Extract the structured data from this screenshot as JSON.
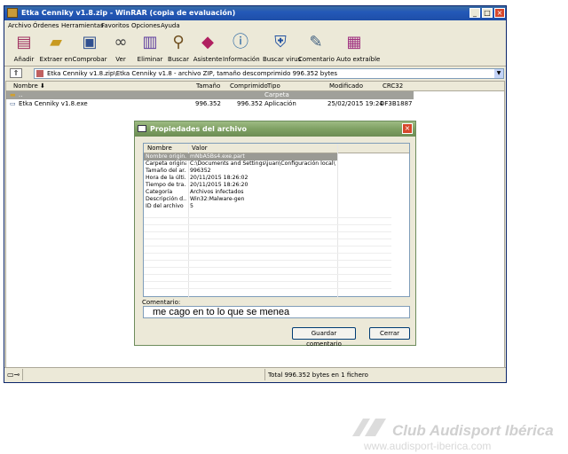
{
  "window": {
    "title": "Etka Cenniky v1.8.zip - WinRAR (copia de evaluación)",
    "controls": {
      "minimize": "_",
      "maximize": "□",
      "close": "×"
    }
  },
  "menu": [
    "Archivo",
    "Órdenes",
    "Herramientas",
    "Favoritos",
    "Opciones",
    "Ayuda"
  ],
  "toolbar": [
    {
      "label": "Añadir",
      "icon": "add-icon"
    },
    {
      "label": "Extraer en",
      "icon": "extract-icon"
    },
    {
      "label": "Comprobar",
      "icon": "test-icon"
    },
    {
      "label": "Ver",
      "icon": "view-icon"
    },
    {
      "label": "Eliminar",
      "icon": "delete-icon"
    },
    {
      "label": "Buscar",
      "icon": "find-icon"
    },
    {
      "label": "Asistente",
      "icon": "wizard-icon"
    },
    {
      "label": "Información",
      "icon": "info-icon"
    },
    {
      "label": "Buscar virus",
      "icon": "virus-scan-icon"
    },
    {
      "label": "Comentario",
      "icon": "comment-icon"
    },
    {
      "label": "Auto extraíble",
      "icon": "sfx-icon"
    }
  ],
  "path": "Etka Cenniky v1.8.zip\\Etka Cenniky v1.8 - archivo ZIP, tamaño descomprimido 996.352 bytes",
  "columns": [
    "Nombre",
    "Tamaño",
    "Comprimido",
    "Tipo",
    "Modificado",
    "CRC32"
  ],
  "files": [
    {
      "name": "..",
      "size": "",
      "packed": "",
      "type": "Carpeta",
      "modified": "",
      "crc": ""
    },
    {
      "name": "Etka Cenniky v1.8.exe",
      "size": "996.352",
      "packed": "996.352",
      "type": "Aplicación",
      "modified": "25/02/2015 19:24",
      "crc": "DF3B1887"
    }
  ],
  "status": "Total 996.352 bytes en 1 fichero",
  "dialog": {
    "title": "Propiedades del archivo",
    "columns": [
      "Nombre",
      "Valor"
    ],
    "rows": [
      {
        "name": "Nombre origin...",
        "value": "mNbA5Bs4.exe.part"
      },
      {
        "name": "Carpeta original",
        "value": "C:\\Documents and Settings\\juan\\Configuración local\\T..."
      },
      {
        "name": "Tamaño del ar...",
        "value": "996352"
      },
      {
        "name": "Hora de la últi...",
        "value": "20/11/2015 18:26:02"
      },
      {
        "name": "Tiempo de tra...",
        "value": "20/11/2015 18:26:20"
      },
      {
        "name": "Categoría",
        "value": "Archivos infectados"
      },
      {
        "name": "Descripción d...",
        "value": "Win32:Malware-gen"
      },
      {
        "name": "ID del archivo",
        "value": "5"
      }
    ],
    "comment_label": "Comentario:",
    "comment_value": "me cago en to lo que se menea",
    "save_button": "Guardar comentario",
    "close_button": "Cerrar"
  },
  "watermark": {
    "brand": "Club Audisport Ibérica",
    "url": "www.audisport-iberica.com"
  }
}
